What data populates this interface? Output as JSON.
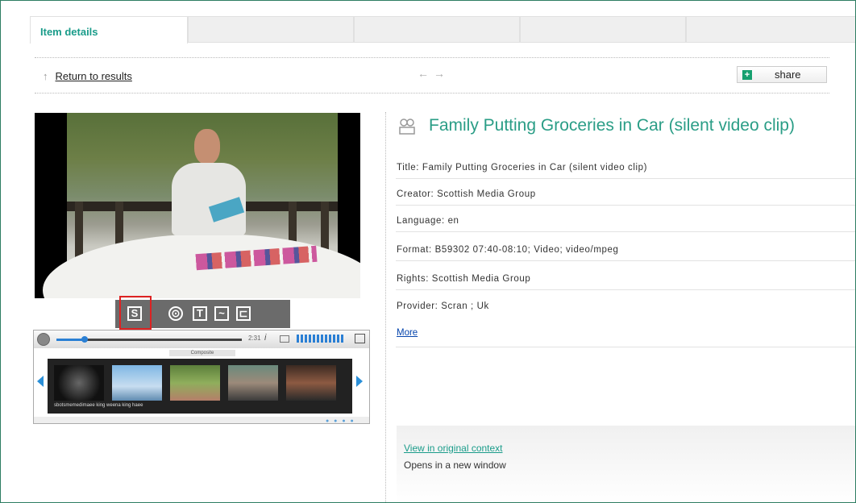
{
  "tabs": [
    {
      "label": "Item details",
      "active": true
    },
    {
      "label": "",
      "active": false
    },
    {
      "label": "",
      "active": false
    },
    {
      "label": "",
      "active": false
    },
    {
      "label": "",
      "active": false
    }
  ],
  "nav": {
    "return_arrow": "↑",
    "return_label": "Return to results",
    "prev_arrow": "←",
    "next_arrow": "→",
    "share_label": "share"
  },
  "toolbar": {
    "s_label": "S",
    "target_glyph": "⊙",
    "t_label": "T",
    "wave_glyph": "~",
    "folder_glyph": "⊏"
  },
  "player": {
    "time": "2:31",
    "info_glyph": "i",
    "progress": 0.15,
    "composite_label": "Composite",
    "caption": "sbotsmemedimaee king weena king haee"
  },
  "item": {
    "title": "Family Putting Groceries in Car (silent video clip)",
    "fields": [
      {
        "label": "Title:",
        "value": "Family Putting Groceries in Car (silent video clip)"
      },
      {
        "label": "Creator:",
        "value": "Scottish Media Group"
      },
      {
        "label": "Language:",
        "value": "en"
      },
      {
        "label": "Format:",
        "value": "B59302 07:40-08:10;  Video;  video/mpeg"
      },
      {
        "label": "Rights:",
        "value": "Scottish Media Group"
      },
      {
        "label": "Provider:",
        "value": "Scran ;  Uk"
      }
    ],
    "more_label": "More",
    "view_link": "View in original context",
    "view_note": "Opens in a new window"
  },
  "colors": {
    "accent": "#1a9c8a",
    "border": "#2e7d62",
    "highlight": "#dd2222",
    "link": "#0645ad"
  }
}
